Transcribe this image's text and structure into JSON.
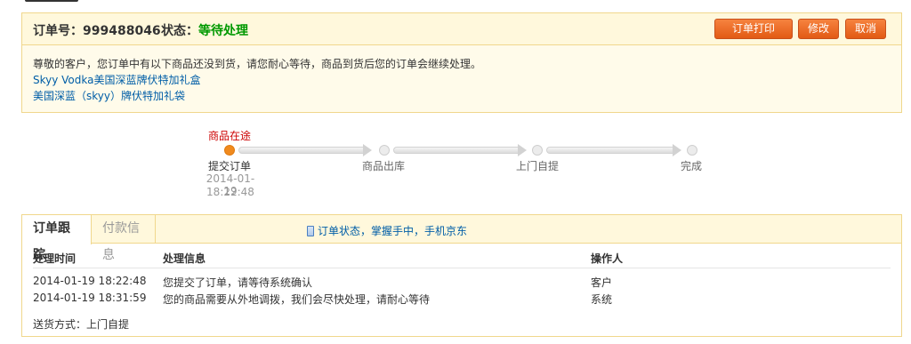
{
  "order": {
    "number_label": "订单号：999488046",
    "status_label": "状态：",
    "status_value": "等待处理",
    "buttons": {
      "print": "订单打印",
      "edit": "修改",
      "cancel": "取消"
    },
    "message": "尊敬的客户，您订单中有以下商品还没到货，请您耐心等待，商品到货后您的订单会继续处理。",
    "pending_items": [
      "Skyy Vodka美国深蓝牌伏特加礼盒",
      "美国深蓝（skyy）牌伏特加礼袋"
    ]
  },
  "progress": {
    "current_label": "商品在途",
    "steps": [
      {
        "label": "提交订单",
        "done": true
      },
      {
        "label": "商品出库",
        "done": false
      },
      {
        "label": "上门自提",
        "done": false
      },
      {
        "label": "完成",
        "done": false
      }
    ],
    "first_step_date": "2014-01-19",
    "first_step_time": "18:22:48"
  },
  "tracking": {
    "tabs": [
      {
        "label": "订单跟踪",
        "active": true
      },
      {
        "label": "付款信息",
        "active": false
      }
    ],
    "mobile_tip": "订单状态，掌握手中，手机京东",
    "headers": {
      "time": "处理时间",
      "info": "处理信息",
      "operator": "操作人"
    },
    "rows": [
      {
        "time": "2014-01-19 18:22:48",
        "info": "您提交了订单，请等待系统确认",
        "operator": "客户"
      },
      {
        "time": "2014-01-19 18:31:59",
        "info": "您的商品需要从外地调拨，我们会尽快处理，请耐心等待",
        "operator": "系统"
      }
    ],
    "shipping": "送货方式：上门自提"
  },
  "colors": {
    "status_green": "#009900",
    "button_orange": "#e25a14",
    "link_blue": "#005ea7",
    "current_step_red": "#cc0000",
    "box_border": "#f0d78c"
  }
}
